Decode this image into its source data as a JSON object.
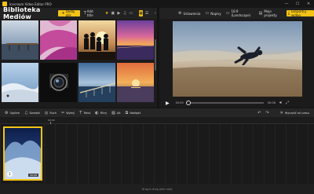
{
  "app": {
    "title": "Icecream Video Editor PRO"
  },
  "window_controls": {
    "minimize": "—",
    "maximize": "☐",
    "close": "✕"
  },
  "library": {
    "title": "Biblioteka Mediów",
    "add_button": "Dodaj plik",
    "add_text_button": "Add title"
  },
  "header_right": {
    "items": [
      {
        "label": "Ustawienia",
        "icon": "gear-icon"
      },
      {
        "label": "Napisy",
        "icon": "subtitles-icon"
      },
      {
        "label": "16:9 (Landscape)",
        "icon": "aspect-ratio-icon"
      },
      {
        "label": "Moje projekty",
        "icon": "folder-icon"
      },
      {
        "label": "Eksportuj wideo",
        "icon": "export-icon"
      }
    ]
  },
  "player": {
    "current_time": "00:00",
    "total_time": "00:08",
    "progress": 0.0
  },
  "toolbar": {
    "items": [
      {
        "label": "Ogólne",
        "icon": "gear-icon"
      },
      {
        "label": "Dzwięki",
        "icon": "music-icon"
      },
      {
        "label": "Ruch",
        "icon": "motion-icon"
      },
      {
        "label": "Wytnij",
        "icon": "scissors-icon"
      },
      {
        "label": "Tekst",
        "icon": "text-icon"
      },
      {
        "label": "Filtry",
        "icon": "filter-icon"
      },
      {
        "label": "Alt",
        "icon": "transition-icon"
      },
      {
        "label": "Nakłądź",
        "icon": "overlay-icon"
      }
    ],
    "clear_label": "Wyczyść oś czasu"
  },
  "timeline": {
    "ruler_label": "00:00",
    "clip": {
      "index": "1",
      "duration": "00:08"
    }
  },
  "footer": {
    "hint": "Drag & drop pliki tutaj"
  },
  "colors": {
    "accent": "#f3c316",
    "background": "#202020"
  }
}
